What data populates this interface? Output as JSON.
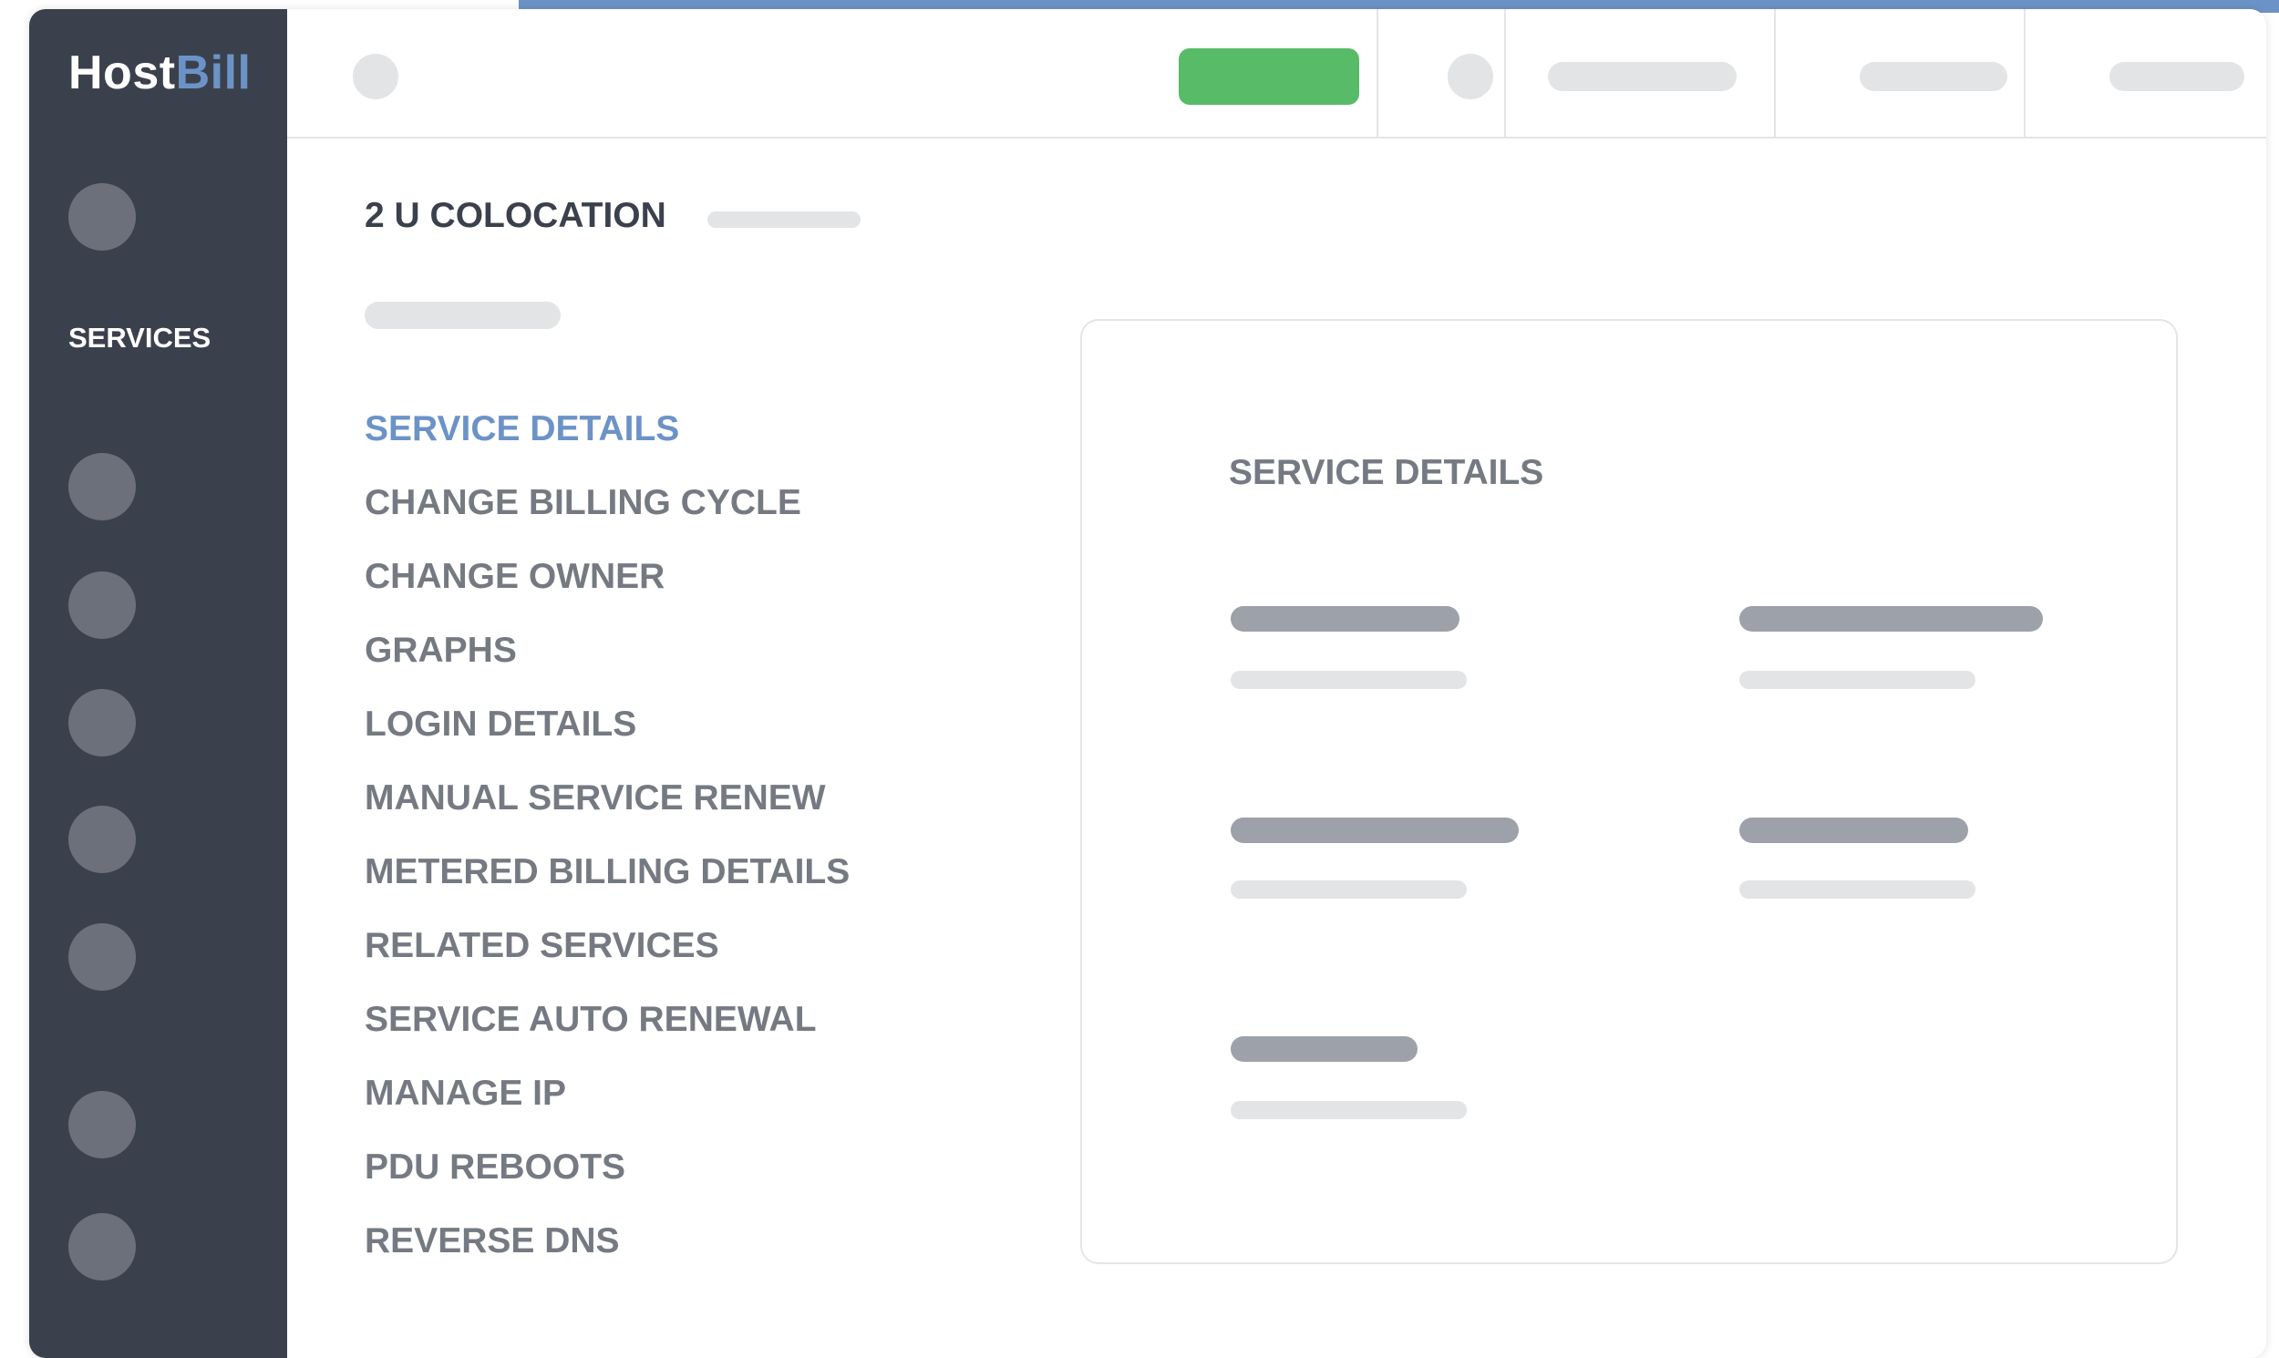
{
  "app": {
    "logo_part1": "Host",
    "logo_part2": "Bill",
    "brand_color": "#6c93c8"
  },
  "sidebar": {
    "section_label": "SERVICES"
  },
  "page": {
    "title": "2 U COLOCATION"
  },
  "menu": {
    "items": [
      {
        "label": "SERVICE DETAILS",
        "active": true
      },
      {
        "label": "CHANGE BILLING CYCLE"
      },
      {
        "label": "CHANGE OWNER"
      },
      {
        "label": "GRAPHS"
      },
      {
        "label": "LOGIN DETAILS"
      },
      {
        "label": "MANUAL SERVICE RENEW"
      },
      {
        "label": "METERED BILLING DETAILS"
      },
      {
        "label": "RELATED SERVICES"
      },
      {
        "label": "SERVICE AUTO RENEWAL"
      },
      {
        "label": "MANAGE IP"
      },
      {
        "label": "PDU REBOOTS"
      },
      {
        "label": "REVERSE DNS"
      }
    ]
  },
  "panel": {
    "title": "SERVICE DETAILS"
  },
  "colors": {
    "sidebar": "#3b414c",
    "accent": "#6c93c8",
    "action_green": "#57bb67",
    "text_muted": "#757a82"
  }
}
